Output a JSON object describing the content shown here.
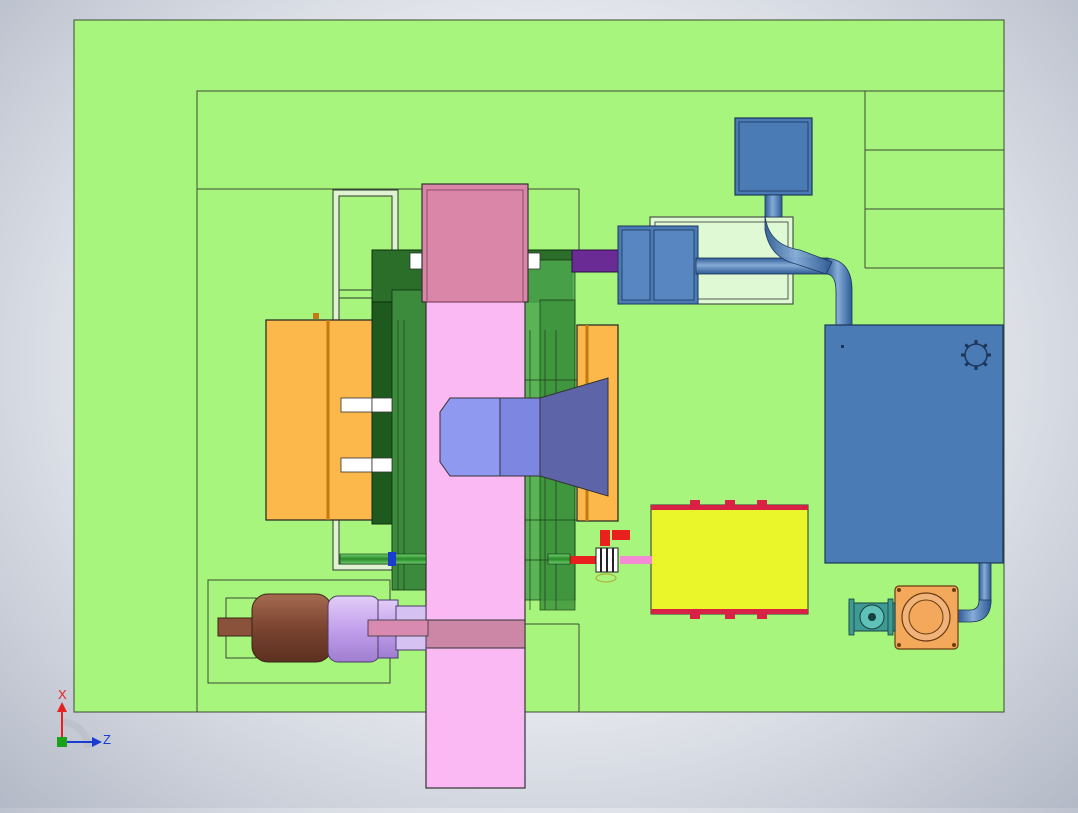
{
  "viewport": {
    "triad": {
      "x_label": "X",
      "z_label": "Z",
      "x_color": "#e8201e",
      "z_color": "#1a3ccf",
      "origin_color": "#1aa21a"
    }
  },
  "colors": {
    "base_plate": "#a7f57d",
    "base_edge": "#3c4a33",
    "central_column": "#fbb9f4",
    "column_top": "#d986a9",
    "orange_block": "#fdb84c",
    "blue_housing": "#4a7bb5",
    "motor_brown": "#8a513b",
    "motor_lilac": "#c8a6ee",
    "yellow_cylinder": "#eaf62a",
    "purple_duct": "#6a2b95",
    "pump_orange": "#f3a85c",
    "valve_teal": "#3e9a93",
    "nozzle_blue": "#8f99f0",
    "dark_green": "#1e5a1e"
  }
}
